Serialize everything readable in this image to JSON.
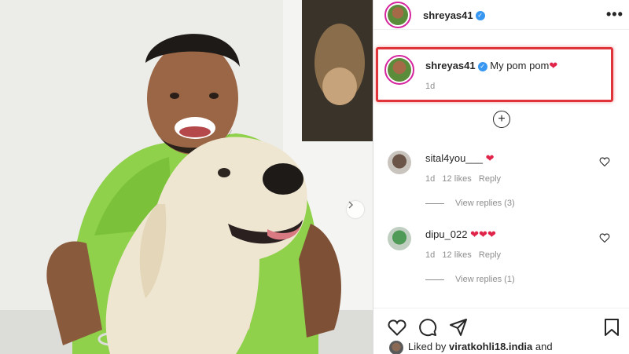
{
  "post": {
    "author": "shreyas41",
    "caption_user": "shreyas41",
    "caption": "My pom pom",
    "caption_age": "1d"
  },
  "comments": [
    {
      "user": "sital4you___",
      "hearts": 1,
      "age": "1d",
      "likes": "12 likes",
      "reply": "Reply",
      "view_replies": "View replies (3)"
    },
    {
      "user": "dipu_022",
      "hearts": 3,
      "age": "1d",
      "likes": "12 likes",
      "reply": "Reply",
      "view_replies": "View replies (1)"
    }
  ],
  "liked_by": {
    "prefix": "Liked by",
    "user": "viratkohli18.india",
    "suffix": "and"
  },
  "icons": {
    "verified": "verified-badge-icon",
    "heart_red": "❤",
    "more": "•••",
    "plus": "+"
  },
  "colors": {
    "accent": "#3897f0",
    "highlight": "#e0333a",
    "heart": "#e0244a"
  }
}
